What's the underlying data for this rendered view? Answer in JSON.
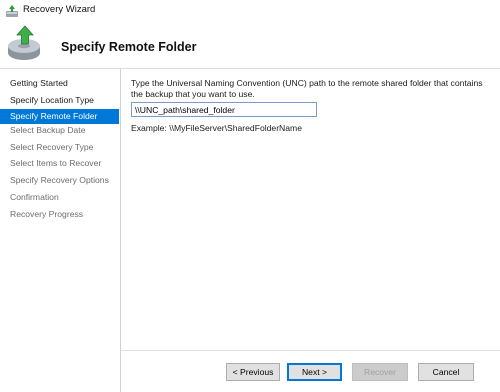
{
  "window": {
    "title": "Recovery Wizard",
    "app_icon": "recovery-wizard-icon"
  },
  "header": {
    "title": "Specify Remote Folder",
    "icon": "backup-restore-icon"
  },
  "sidebar": {
    "items": [
      {
        "label": "Getting Started",
        "state": "visited"
      },
      {
        "label": "Specify Location Type",
        "state": "visited"
      },
      {
        "label": "Specify Remote Folder",
        "state": "current"
      },
      {
        "label": "Select Backup Date",
        "state": "future"
      },
      {
        "label": "Select Recovery Type",
        "state": "future"
      },
      {
        "label": "Select Items to Recover",
        "state": "future"
      },
      {
        "label": "Specify Recovery Options",
        "state": "future"
      },
      {
        "label": "Confirmation",
        "state": "future"
      },
      {
        "label": "Recovery Progress",
        "state": "future"
      }
    ]
  },
  "main": {
    "instructions": "Type the Universal Naming Convention (UNC) path to the remote shared folder that contains the backup that you want to use.",
    "path_value": "\\\\UNC_path\\shared_folder",
    "example": "Example: \\\\MyFileServer\\SharedFolderName"
  },
  "buttons": {
    "previous": "< Previous",
    "next": "Next >",
    "recover": "Recover",
    "cancel": "Cancel"
  },
  "colors": {
    "accent": "#0078d7",
    "future_step": "#6d6d6d"
  }
}
